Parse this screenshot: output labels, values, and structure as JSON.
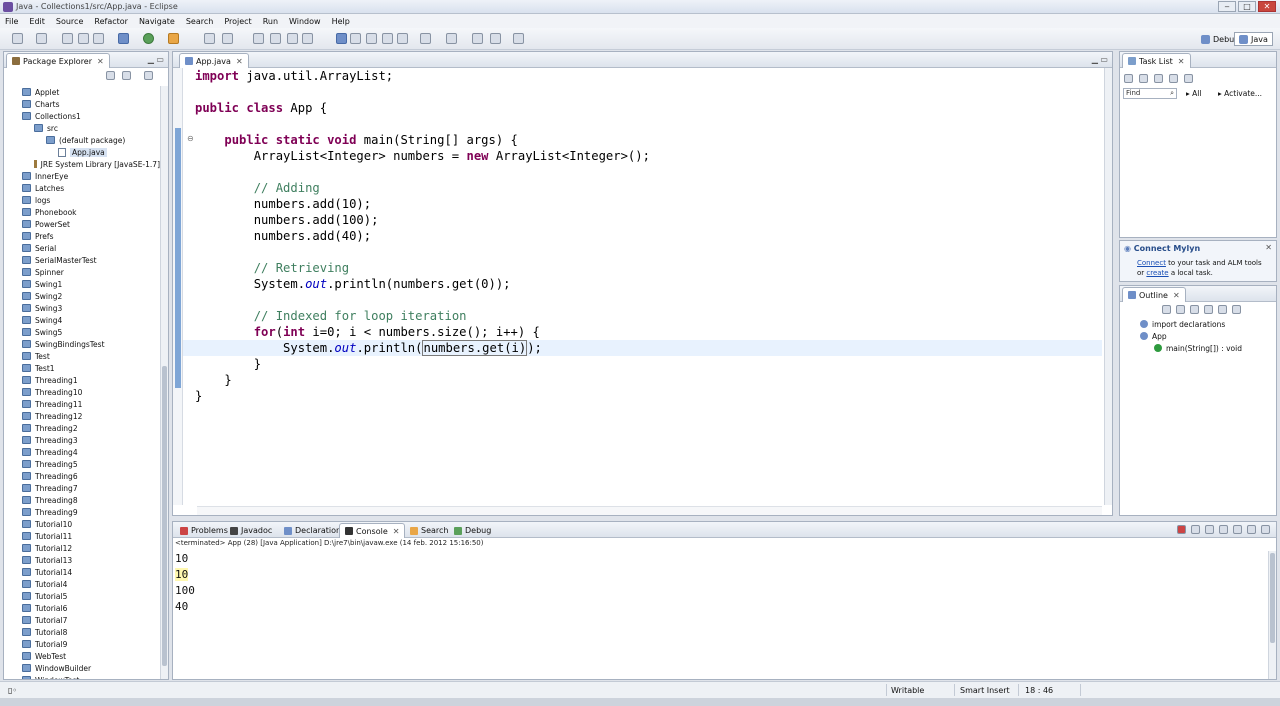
{
  "window": {
    "title": "Java - Collections1/src/App.java - Eclipse"
  },
  "menu": [
    "File",
    "Edit",
    "Source",
    "Refactor",
    "Navigate",
    "Search",
    "Project",
    "Run",
    "Window",
    "Help"
  ],
  "perspectives": {
    "debug": "Debug",
    "java": "Java"
  },
  "package_explorer": {
    "title": "Package Explorer",
    "items": [
      {
        "label": "Applet",
        "indent": 0,
        "type": "project"
      },
      {
        "label": "Charts",
        "indent": 0,
        "type": "project"
      },
      {
        "label": "Collections1",
        "indent": 0,
        "type": "project"
      },
      {
        "label": "src",
        "indent": 1,
        "type": "folder"
      },
      {
        "label": "(default package)",
        "indent": 2,
        "type": "package"
      },
      {
        "label": "App.java",
        "indent": 3,
        "type": "file",
        "selected": true
      },
      {
        "label": "JRE System Library [JavaSE-1.7]",
        "indent": 1,
        "type": "lib"
      },
      {
        "label": "InnerEye",
        "indent": 0,
        "type": "project"
      },
      {
        "label": "Latches",
        "indent": 0,
        "type": "project"
      },
      {
        "label": "logs",
        "indent": 0,
        "type": "project"
      },
      {
        "label": "Phonebook",
        "indent": 0,
        "type": "project"
      },
      {
        "label": "PowerSet",
        "indent": 0,
        "type": "project"
      },
      {
        "label": "Prefs",
        "indent": 0,
        "type": "project"
      },
      {
        "label": "Serial",
        "indent": 0,
        "type": "project"
      },
      {
        "label": "SerialMasterTest",
        "indent": 0,
        "type": "project"
      },
      {
        "label": "Spinner",
        "indent": 0,
        "type": "project"
      },
      {
        "label": "Swing1",
        "indent": 0,
        "type": "project"
      },
      {
        "label": "Swing2",
        "indent": 0,
        "type": "project"
      },
      {
        "label": "Swing3",
        "indent": 0,
        "type": "project"
      },
      {
        "label": "Swing4",
        "indent": 0,
        "type": "project"
      },
      {
        "label": "Swing5",
        "indent": 0,
        "type": "project"
      },
      {
        "label": "SwingBindingsTest",
        "indent": 0,
        "type": "project"
      },
      {
        "label": "Test",
        "indent": 0,
        "type": "project"
      },
      {
        "label": "Test1",
        "indent": 0,
        "type": "project"
      },
      {
        "label": "Threading1",
        "indent": 0,
        "type": "project"
      },
      {
        "label": "Threading10",
        "indent": 0,
        "type": "project"
      },
      {
        "label": "Threading11",
        "indent": 0,
        "type": "project"
      },
      {
        "label": "Threading12",
        "indent": 0,
        "type": "project"
      },
      {
        "label": "Threading2",
        "indent": 0,
        "type": "project"
      },
      {
        "label": "Threading3",
        "indent": 0,
        "type": "project"
      },
      {
        "label": "Threading4",
        "indent": 0,
        "type": "project"
      },
      {
        "label": "Threading5",
        "indent": 0,
        "type": "project"
      },
      {
        "label": "Threading6",
        "indent": 0,
        "type": "project"
      },
      {
        "label": "Threading7",
        "indent": 0,
        "type": "project"
      },
      {
        "label": "Threading8",
        "indent": 0,
        "type": "project"
      },
      {
        "label": "Threading9",
        "indent": 0,
        "type": "project"
      },
      {
        "label": "Tutorial10",
        "indent": 0,
        "type": "project"
      },
      {
        "label": "Tutorial11",
        "indent": 0,
        "type": "project"
      },
      {
        "label": "Tutorial12",
        "indent": 0,
        "type": "project"
      },
      {
        "label": "Tutorial13",
        "indent": 0,
        "type": "project"
      },
      {
        "label": "Tutorial14",
        "indent": 0,
        "type": "project"
      },
      {
        "label": "Tutorial4",
        "indent": 0,
        "type": "project"
      },
      {
        "label": "Tutorial5",
        "indent": 0,
        "type": "project"
      },
      {
        "label": "Tutorial6",
        "indent": 0,
        "type": "project"
      },
      {
        "label": "Tutorial7",
        "indent": 0,
        "type": "project"
      },
      {
        "label": "Tutorial8",
        "indent": 0,
        "type": "project"
      },
      {
        "label": "Tutorial9",
        "indent": 0,
        "type": "project"
      },
      {
        "label": "WebTest",
        "indent": 0,
        "type": "project"
      },
      {
        "label": "WindowBuilder",
        "indent": 0,
        "type": "project"
      },
      {
        "label": "WindowTest",
        "indent": 0,
        "type": "project"
      }
    ]
  },
  "editor": {
    "tab": "App.java",
    "lines": [
      [
        [
          "kw",
          "import"
        ],
        [
          "t",
          " java.util.ArrayList;"
        ]
      ],
      [],
      [
        [
          "kw",
          "public class"
        ],
        [
          "t",
          " App {"
        ]
      ],
      [],
      [
        [
          "t",
          "    "
        ],
        [
          "kw",
          "public static void"
        ],
        [
          "t",
          " main(String[] args) {"
        ]
      ],
      [
        [
          "t",
          "        ArrayList<Integer> numbers = "
        ],
        [
          "kw",
          "new"
        ],
        [
          "t",
          " ArrayList<Integer>();"
        ]
      ],
      [],
      [
        [
          "t",
          "        "
        ],
        [
          "cm",
          "// Adding"
        ]
      ],
      [
        [
          "t",
          "        numbers.add(10);"
        ]
      ],
      [
        [
          "t",
          "        numbers.add(100);"
        ]
      ],
      [
        [
          "t",
          "        numbers.add(40);"
        ]
      ],
      [],
      [
        [
          "t",
          "        "
        ],
        [
          "cm",
          "// Retrieving"
        ]
      ],
      [
        [
          "t",
          "        System."
        ],
        [
          "it",
          "out"
        ],
        [
          "t",
          ".println(numbers.get(0));"
        ]
      ],
      [],
      [
        [
          "t",
          "        "
        ],
        [
          "cm",
          "// Indexed for loop iteration"
        ]
      ],
      [
        [
          "t",
          "        "
        ],
        [
          "kw",
          "for"
        ],
        [
          "t",
          "("
        ],
        [
          "kw",
          "int"
        ],
        [
          "t",
          " i=0; i < numbers.size(); i++) {"
        ]
      ],
      [
        [
          "t",
          "            System."
        ],
        [
          "it",
          "out"
        ],
        [
          "t",
          ".println("
        ],
        [
          "box",
          "numbers.get(i)"
        ],
        [
          "t",
          ");"
        ]
      ],
      [
        [
          "t",
          "        }"
        ]
      ],
      [
        [
          "t",
          "    }"
        ]
      ],
      [
        [
          "t",
          "}"
        ]
      ]
    ],
    "current_line": 17
  },
  "task_list": {
    "title": "Task List",
    "find_placeholder": "Find",
    "all": "All",
    "activate": "Activate..."
  },
  "mylyn": {
    "title": "Connect Mylyn",
    "line1_link": "Connect",
    "line1_rest": " to your task and ALM tools",
    "line2_pre": "or ",
    "line2_link": "create",
    "line2_rest": " a local task."
  },
  "outline": {
    "title": "Outline",
    "items": [
      {
        "label": "import declarations",
        "indent": 0
      },
      {
        "label": "App",
        "indent": 0
      },
      {
        "label": "main(String[]) : void",
        "indent": 1
      }
    ]
  },
  "console": {
    "tabs": [
      "Problems",
      "Javadoc",
      "Declaration",
      "Console",
      "Search",
      "Debug"
    ],
    "active_tab": "Console",
    "header": "<terminated> App (28) [Java Application] D:\\jre7\\bin\\javaw.exe (14 feb. 2012 15:16:50)",
    "output": [
      "10",
      "10",
      "100",
      "40"
    ],
    "highlight_line": 1
  },
  "status": {
    "writable": "Writable",
    "insert_mode": "Smart Insert",
    "position": "18 : 46"
  }
}
